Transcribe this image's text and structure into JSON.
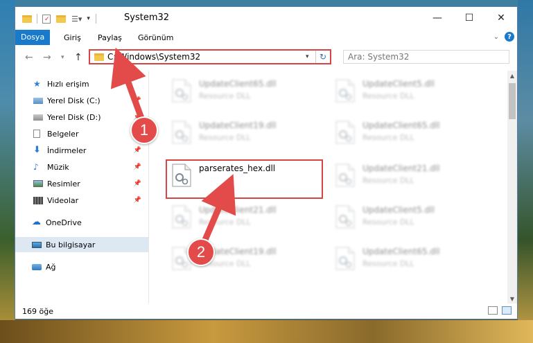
{
  "window": {
    "title": "System32",
    "controls": {
      "minimize": "—",
      "maximize": "☐",
      "close": "✕"
    }
  },
  "ribbon": {
    "tabs": [
      "Dosya",
      "Giriş",
      "Paylaş",
      "Görünüm"
    ]
  },
  "navbar": {
    "address": "C:\\Windows\\System32",
    "search_placeholder": "Ara: System32"
  },
  "sidebar": {
    "items": [
      {
        "label": "Hızlı erişim",
        "icon": "star-icon"
      },
      {
        "label": "Yerel Disk (C:)",
        "icon": "drive-icon"
      },
      {
        "label": "Yerel Disk (D:)",
        "icon": "drive-icon"
      },
      {
        "label": "Belgeler",
        "icon": "document-icon"
      },
      {
        "label": "İndirmeler",
        "icon": "download-icon"
      },
      {
        "label": "Müzik",
        "icon": "music-icon"
      },
      {
        "label": "Resimler",
        "icon": "pictures-icon"
      },
      {
        "label": "Videolar",
        "icon": "video-icon"
      },
      {
        "label": "OneDrive",
        "icon": "cloud-icon"
      },
      {
        "label": "Bu bilgisayar",
        "icon": "computer-icon"
      },
      {
        "label": "Ağ",
        "icon": "network-icon"
      }
    ]
  },
  "files": [
    {
      "name": "UpdateClient65.dll",
      "type": "Resource DLL"
    },
    {
      "name": "UpdateClient5.dll",
      "type": "Resource DLL"
    },
    {
      "name": "UpdateClient19.dll",
      "type": "Resource DLL"
    },
    {
      "name": "UpdateClient65.dll",
      "type": "Resource DLL"
    },
    {
      "name": "parserates_hex.dll",
      "type": ""
    },
    {
      "name": "UpdateClient21.dll",
      "type": "Resource DLL"
    },
    {
      "name": "UpdateClient21.dll",
      "type": "Resource DLL"
    },
    {
      "name": "UpdateClient5.dll",
      "type": "Resource DLL"
    },
    {
      "name": "UpdateClient19.dll",
      "type": "Resource DLL"
    },
    {
      "name": "UpdateClient65.dll",
      "type": "Resource DLL"
    }
  ],
  "status": {
    "item_count": "169 öğe"
  },
  "annotations": {
    "step1": "1",
    "step2": "2"
  },
  "colors": {
    "accent": "#1979ca",
    "highlight": "#d64545"
  }
}
